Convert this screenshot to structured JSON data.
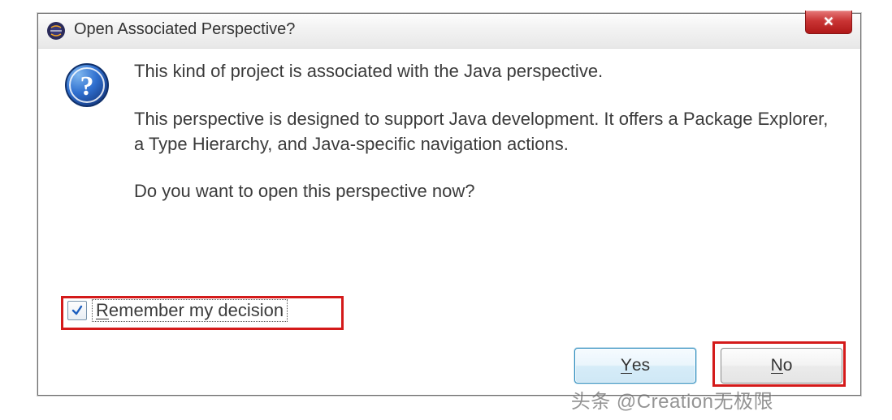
{
  "titlebar": {
    "title": "Open Associated Perspective?"
  },
  "message": {
    "line1": "This kind of project is associated with the Java perspective.",
    "line2": "This perspective is designed to support Java development. It offers a Package Explorer, a Type Hierarchy, and Java-specific navigation actions.",
    "line3": "Do you want to open this perspective now?"
  },
  "checkbox": {
    "checked": true,
    "label_prefix": "R",
    "label_rest": "emember my decision"
  },
  "buttons": {
    "yes_prefix": "Y",
    "yes_rest": "es",
    "no_prefix": "N",
    "no_rest": "o"
  },
  "watermark": "头条 @Creation无极限"
}
